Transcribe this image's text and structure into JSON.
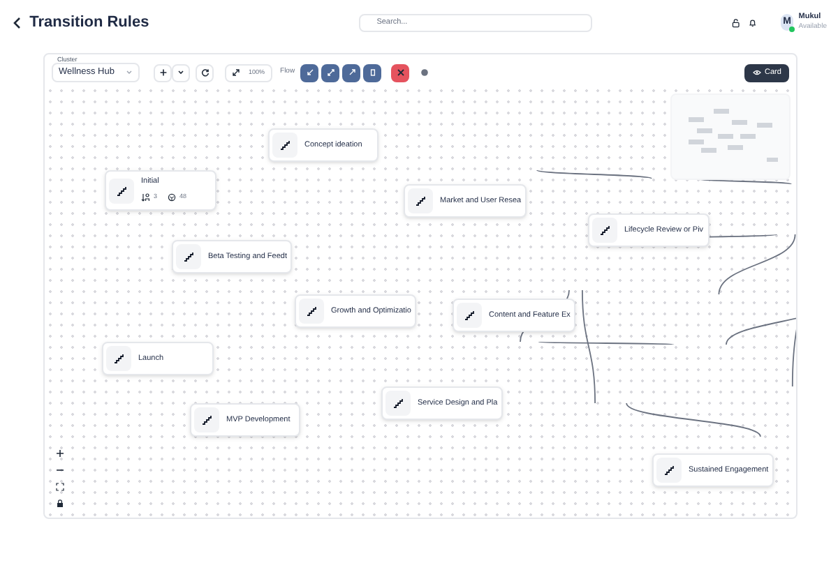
{
  "header": {
    "title": "Transition Rules",
    "search": {
      "placeholder": "Search..."
    },
    "user": {
      "initial": "M",
      "name": "Mukul",
      "status": "Available"
    }
  },
  "toolbar": {
    "cluster_label": "Cluster",
    "cluster_value": "Wellness Hub",
    "zoom": "100%",
    "flow_label": "Flow",
    "card_button": "Card"
  },
  "nodes": [
    {
      "label": "Initial",
      "stats": [
        "3",
        "48"
      ]
    },
    {
      "label": "Concept ideation"
    },
    {
      "label": "Market and User Resea"
    },
    {
      "label": "Lifecycle Review or Piv"
    },
    {
      "label": "Beta Testing and Feedt"
    },
    {
      "label": "Growth and Optimizatio"
    },
    {
      "label": "Content and Feature Ex"
    },
    {
      "label": "Launch"
    },
    {
      "label": "Service Design and Pla"
    },
    {
      "label": "MVP Development"
    },
    {
      "label": "Sustained Engagement"
    }
  ]
}
